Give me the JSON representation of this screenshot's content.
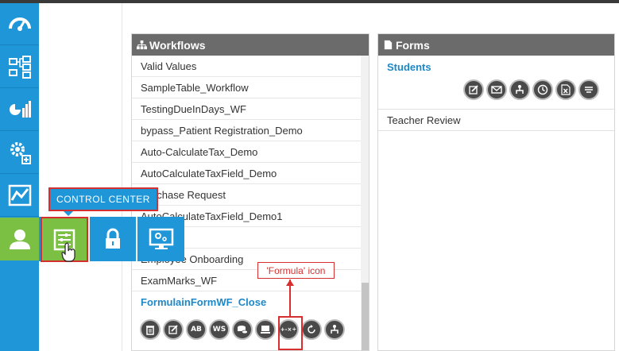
{
  "control_center": {
    "tooltip": "CONTROL CENTER",
    "items": [
      {
        "icon": "sliders-icon"
      },
      {
        "icon": "lock-icon"
      },
      {
        "icon": "monitor-settings-icon"
      }
    ]
  },
  "workflows": {
    "title": "Workflows",
    "items": [
      "Valid Values",
      "SampleTable_Workflow",
      "TestingDueInDays_WF",
      "bypass_Patient Registration_Demo",
      "Auto-CalculateTax_Demo",
      "AutoCalculateTaxField_Demo",
      "Purchase Request",
      "AutoCalculateTaxField_Demo1",
      "",
      "Employee Onboarding",
      "ExamMarks_WF"
    ],
    "active_item": "FormulainFormWF_Close",
    "action_icons": [
      {
        "name": "delete-icon",
        "label": ""
      },
      {
        "name": "edit-icon",
        "label": ""
      },
      {
        "name": "ab-icon",
        "label": "AB"
      },
      {
        "name": "ws-icon",
        "label": "WS"
      },
      {
        "name": "database-icon",
        "label": ""
      },
      {
        "name": "keyboard-icon",
        "label": ""
      },
      {
        "name": "formula-icon",
        "label": "+-×÷"
      },
      {
        "name": "refresh-icon",
        "label": ""
      },
      {
        "name": "hierarchy-icon",
        "label": ""
      }
    ]
  },
  "forms": {
    "title": "Forms",
    "students": "Students",
    "teacher_review": "Teacher Review",
    "action_icons": [
      {
        "name": "edit-icon"
      },
      {
        "name": "mail-icon"
      },
      {
        "name": "hierarchy-icon"
      },
      {
        "name": "clock-icon"
      },
      {
        "name": "excel-icon"
      },
      {
        "name": "list-icon"
      }
    ]
  },
  "annotation": {
    "label": "'Formula' icon"
  },
  "colors": {
    "accent_blue": "#1e96d8",
    "accent_green": "#7bc043",
    "annotation_red": "#d62f2f",
    "header_gray": "#6b6b6b"
  }
}
